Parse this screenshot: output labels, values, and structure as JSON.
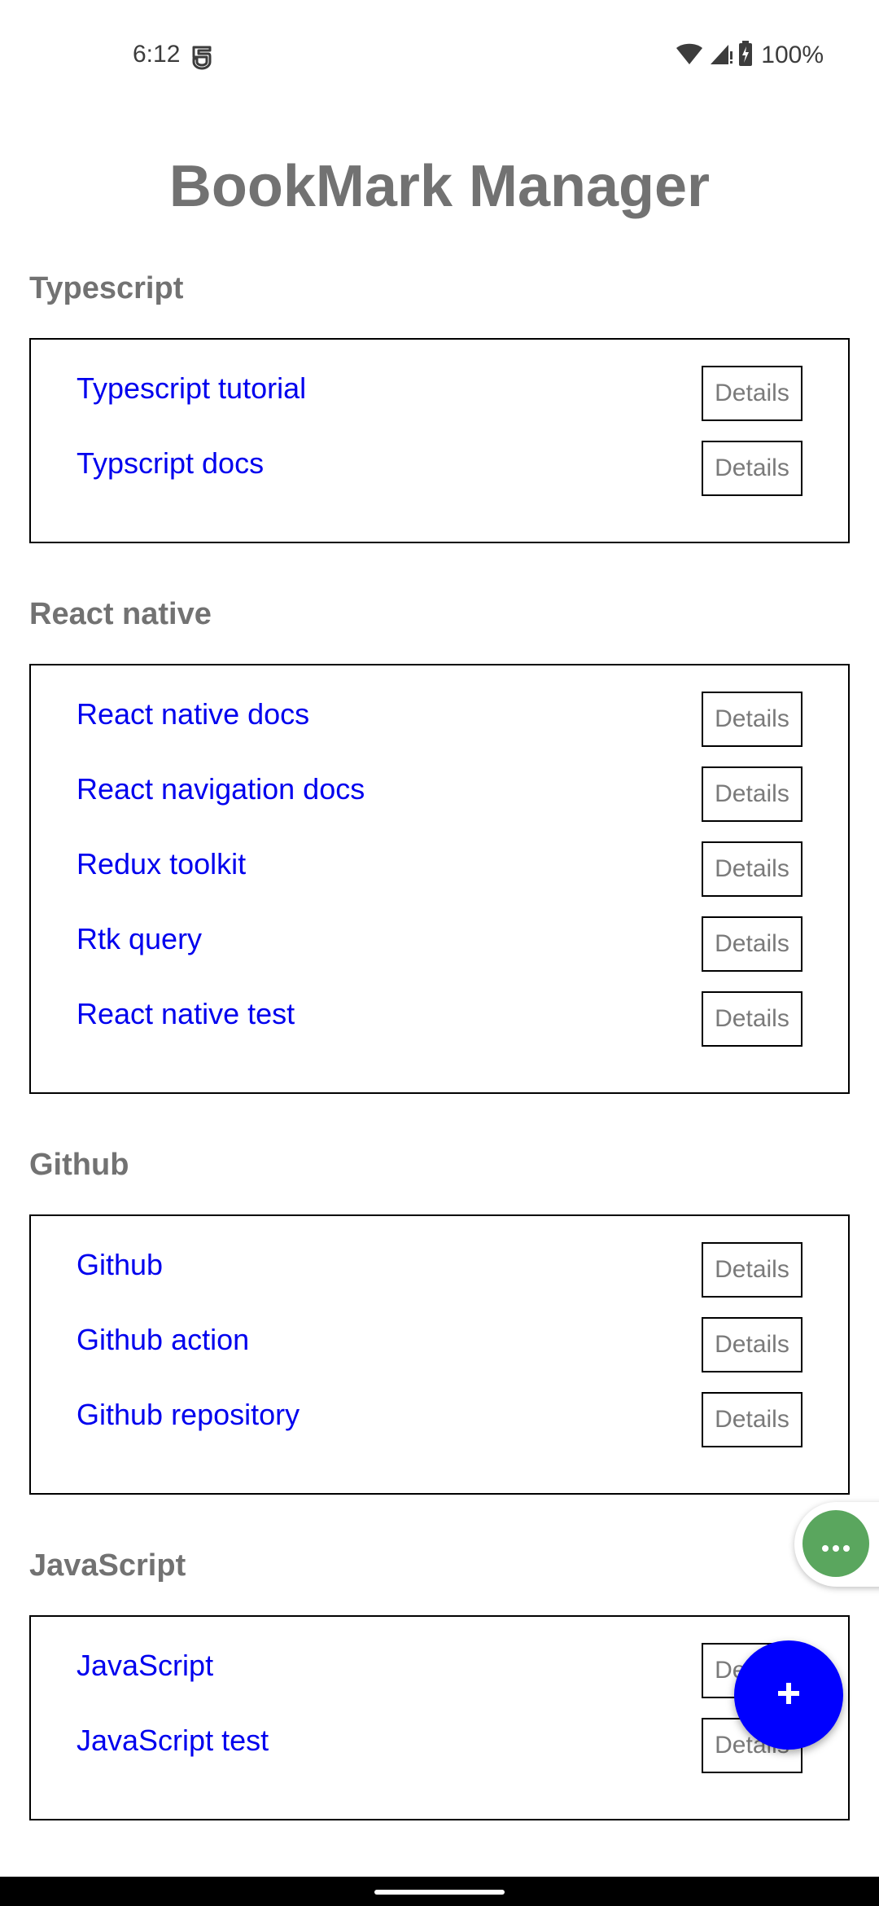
{
  "status_bar": {
    "time": "6:12",
    "battery": "100%",
    "icons": [
      "notification-icon",
      "wifi-icon",
      "signal-icon",
      "battery-charging-icon"
    ]
  },
  "app": {
    "title": "BookMark Manager",
    "colors": {
      "title": "#727272",
      "link": "#0000ee",
      "fab": "#0000ff",
      "bubble": "#5aa65e"
    }
  },
  "categories": [
    {
      "name": "Typescript",
      "bookmarks": [
        {
          "title": "Typescript tutorial",
          "action": "Details"
        },
        {
          "title": "Typscript docs",
          "action": "Details"
        }
      ]
    },
    {
      "name": "React native",
      "bookmarks": [
        {
          "title": "React native docs",
          "action": "Details"
        },
        {
          "title": "React navigation docs",
          "action": "Details"
        },
        {
          "title": "Redux toolkit",
          "action": "Details"
        },
        {
          "title": "Rtk query",
          "action": "Details"
        },
        {
          "title": "React native test",
          "action": "Details"
        }
      ]
    },
    {
      "name": "Github",
      "bookmarks": [
        {
          "title": "Github",
          "action": "Details"
        },
        {
          "title": "Github action",
          "action": "Details"
        },
        {
          "title": "Github repository",
          "action": "Details"
        }
      ]
    },
    {
      "name": "JavaScript",
      "bookmarks": [
        {
          "title": "JavaScript",
          "action": "Details"
        },
        {
          "title": "JavaScript test",
          "action": "Details"
        }
      ]
    }
  ],
  "floating": {
    "bubble_icon": "more-horizontal-icon",
    "fab_icon": "plus-icon"
  }
}
